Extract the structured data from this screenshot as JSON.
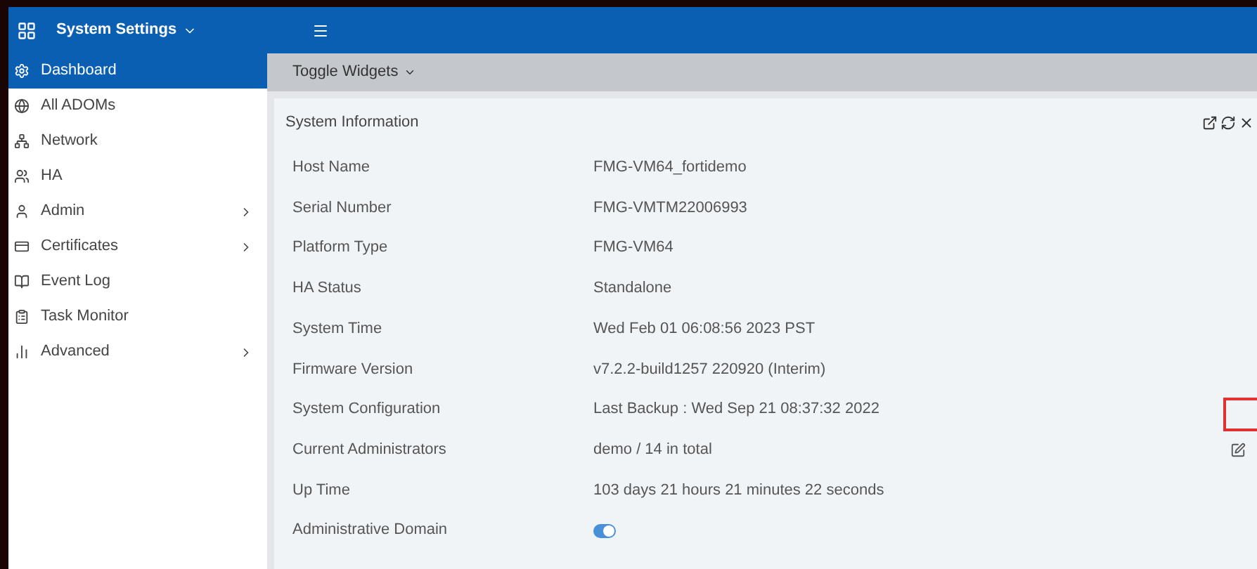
{
  "header": {
    "title": "System Settings"
  },
  "sidebar": {
    "items": [
      {
        "label": "Dashboard",
        "selected": true,
        "submenu": false
      },
      {
        "label": "All ADOMs",
        "selected": false,
        "submenu": false
      },
      {
        "label": "Network",
        "selected": false,
        "submenu": false
      },
      {
        "label": "HA",
        "selected": false,
        "submenu": false
      },
      {
        "label": "Admin",
        "selected": false,
        "submenu": true
      },
      {
        "label": "Certificates",
        "selected": false,
        "submenu": true
      },
      {
        "label": "Event Log",
        "selected": false,
        "submenu": false
      },
      {
        "label": "Task Monitor",
        "selected": false,
        "submenu": false
      },
      {
        "label": "Advanced",
        "selected": false,
        "submenu": true
      }
    ]
  },
  "toolbar": {
    "toggle_widgets": "Toggle Widgets"
  },
  "widget": {
    "title": "System Information",
    "rows": [
      {
        "label": "Host Name",
        "kind": "text",
        "value": "FMG-VM64_fortidemo"
      },
      {
        "label": "Serial Number",
        "kind": "text",
        "value": "FMG-VMTM22006993"
      },
      {
        "label": "Platform Type",
        "kind": "text",
        "value": "FMG-VM64"
      },
      {
        "label": "HA Status",
        "kind": "text",
        "value": "Standalone"
      },
      {
        "label": "System Time",
        "kind": "text",
        "value": "Wed Feb 01 06:08:56 2023 PST"
      },
      {
        "label": "Firmware Version",
        "kind": "text",
        "value": "v7.2.2-build1257 220920 (Interim)"
      },
      {
        "label": "System Configuration",
        "kind": "text",
        "value": "Last Backup : Wed Sep 21 08:37:32 2022",
        "highlighted": true
      },
      {
        "label": "Current Administrators",
        "kind": "text",
        "value": "demo / 14 in total",
        "editable": true
      },
      {
        "label": "Up Time",
        "kind": "text",
        "value": "103 days 21 hours 21 minutes 22 seconds"
      },
      {
        "label": "Administrative Domain",
        "kind": "toggle",
        "on": true
      }
    ]
  }
}
